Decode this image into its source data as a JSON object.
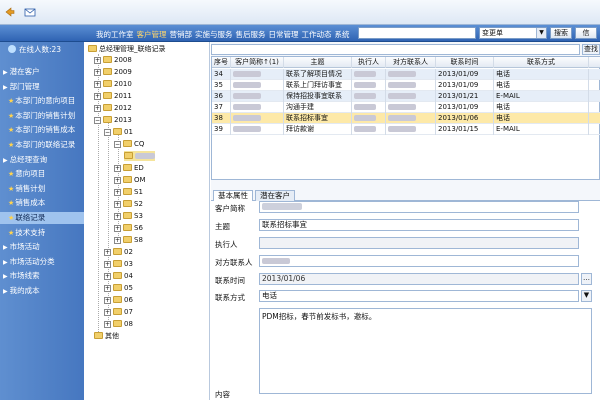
{
  "topbar": {
    "back_icon": "back-arrow-icon",
    "mail_icon": "mail-icon"
  },
  "mainbar": {
    "nav": [
      "我的工作室",
      "客户管理",
      "营销部",
      "实施与服务",
      "售后服务",
      "日常管理",
      "工作动态",
      "系统"
    ],
    "active_index": 1,
    "search_value": "",
    "select_value": "变更单",
    "search_button": "搜索",
    "extra_button": "信"
  },
  "left": {
    "online_label": "在线人数:23",
    "items": [
      {
        "label": "潜在客户",
        "level": 0,
        "selected": false
      },
      {
        "label": "部门管理",
        "level": 0,
        "selected": false
      },
      {
        "label": "本部门的意向项目",
        "level": 1,
        "selected": false
      },
      {
        "label": "本部门的销售计划",
        "level": 1,
        "selected": false
      },
      {
        "label": "本部门的销售成本",
        "level": 1,
        "selected": false
      },
      {
        "label": "本部门的联络记录",
        "level": 1,
        "selected": false
      },
      {
        "label": "总经理查询",
        "level": 0,
        "selected": false
      },
      {
        "label": "意向项目",
        "level": 1,
        "selected": false
      },
      {
        "label": "销售计划",
        "level": 1,
        "selected": false
      },
      {
        "label": "销售成本",
        "level": 1,
        "selected": false
      },
      {
        "label": "联络记录",
        "level": 1,
        "selected": true
      },
      {
        "label": "技术支持",
        "level": 1,
        "selected": false
      },
      {
        "label": "市场活动",
        "level": 0,
        "selected": false
      },
      {
        "label": "市场活动分类",
        "level": 0,
        "selected": false
      },
      {
        "label": "市场线索",
        "level": 0,
        "selected": false
      },
      {
        "label": "我的成本",
        "level": 0,
        "selected": false
      }
    ]
  },
  "tree": {
    "root": "总经理管理_联络记录",
    "nodes": [
      "2008",
      "2009",
      "2010",
      "2011",
      "2012",
      "2013",
      "01",
      "CQ",
      "ED",
      "OM",
      "S1",
      "S2",
      "S3",
      "S6",
      "S8",
      "02",
      "03",
      "04",
      "05",
      "06",
      "07",
      "08",
      "其他"
    ]
  },
  "grid": {
    "filter_value": "",
    "query_button": "查找",
    "columns": [
      "序号",
      "客户简称↑(1)",
      "主题",
      "执行人",
      "对方联系人",
      "联系时间",
      "联系方式"
    ],
    "rows": [
      {
        "no": "34",
        "subject": "联系了解项目情况",
        "date": "2013/01/09",
        "method": "电话"
      },
      {
        "no": "35",
        "subject": "联系上门拜访事宜",
        "date": "2013/01/09",
        "method": "电话"
      },
      {
        "no": "36",
        "subject": "保持招投事宜联系",
        "date": "2013/01/21",
        "method": "E-MAIL"
      },
      {
        "no": "37",
        "subject": "沟通手建",
        "date": "2013/01/09",
        "method": "电话"
      },
      {
        "no": "38",
        "subject": "联系招标事宜",
        "date": "2013/01/06",
        "method": "电话"
      },
      {
        "no": "39",
        "subject": "拜访款谢",
        "date": "2013/01/15",
        "method": "E-MAIL"
      }
    ]
  },
  "tabs": [
    "基本属性",
    "潜在客户"
  ],
  "form": {
    "labels": [
      "客户简称",
      "主题",
      "执行人",
      "对方联系人",
      "联系时间",
      "联系方式",
      "内容"
    ],
    "subject": "联系招标事宜",
    "date": "2013/01/06",
    "method": "电话",
    "content": "PDM招标，春节前发标书，邀标。"
  }
}
